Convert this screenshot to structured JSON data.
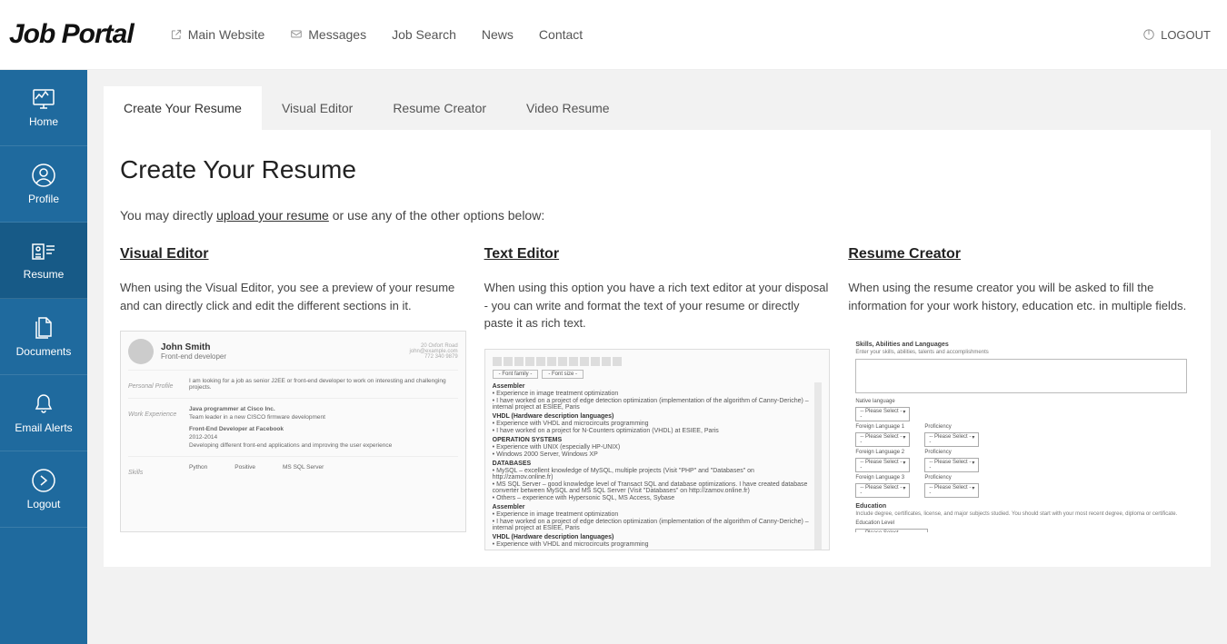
{
  "brand": "Job Portal",
  "topnav": {
    "main_website": "Main Website",
    "messages": "Messages",
    "job_search": "Job Search",
    "news": "News",
    "contact": "Contact"
  },
  "logout": "LOGOUT",
  "sidebar": {
    "home": "Home",
    "profile": "Profile",
    "resume": "Resume",
    "documents": "Documents",
    "email_alerts": "Email Alerts",
    "logout": "Logout"
  },
  "tabs": {
    "create": "Create Your Resume",
    "visual": "Visual Editor",
    "creator": "Resume Creator",
    "video": "Video Resume"
  },
  "page": {
    "title": "Create Your Resume",
    "intro_prefix": "You may directly ",
    "intro_link": "upload your resume",
    "intro_suffix": " or use any of the other options below:"
  },
  "cols": {
    "visual": {
      "title": "Visual Editor",
      "desc": "When using the Visual Editor, you see a preview of your resume and can directly click and edit the different sections in it."
    },
    "text": {
      "title": "Text Editor",
      "desc": "When using this option you have a rich text editor at your disposal - you can write and format the text of your resume or directly paste it as rich text."
    },
    "creator": {
      "title": "Resume Creator",
      "desc": "When using the resume creator you will be asked to fill the information for your work history, education etc. in multiple fields."
    }
  },
  "thumb_visual": {
    "name": "John Smith",
    "role": "Front-end developer",
    "contact1": "20 Oxfort Road",
    "contact2": "john@example.com",
    "contact3": "772 340 9879",
    "profile_h": "Personal Profile",
    "profile_t": "I am looking for a job as senior J2EE or front-end developer to work on interesting and challenging projects.",
    "work_h": "Work Experience",
    "work1_t": "Java programmer at Cisco Inc.",
    "work1_d": "Team leader in a new CISCO firmware development",
    "work2_t": "Front-End Developer at Facebook",
    "work2_y": "2012-2014",
    "work2_d": "Developing different front-end applications and improving the user experience",
    "skills_h": "Skills",
    "skill1": "Python",
    "skill2": "Positive",
    "skill3": "MS SQL Server"
  },
  "thumb_text": {
    "font_family": "- Font family -",
    "font_size": "- Font size -",
    "h1": "Assembler",
    "l1": "Experience in image treatment optimization",
    "l2": "I have worked on a project of edge detection optimization (implementation of the algorithm of Canny-Deriche) – internal project at ESIEE, Paris",
    "h2": "VHDL (Hardware description languages)",
    "l3": "Experience with VHDL and microcircuits programming",
    "l4": "I have worked on a project for N-Counters optimization (VHDL) at ESIEE, Paris",
    "h3": "OPERATION SYSTEMS",
    "l5": "Experience with UNIX (especially HP-UNIX)",
    "l6": "Windows 2000 Server, Windows XP",
    "h4": "DATABASES",
    "l7": "MySQL – excellent knowledge of MySQL, multiple projects (Visit \"PHP\" and \"Databases\" on http://zamov.online.fr)",
    "l8": "MS SQL Server – good knowledge level of Transact SQL and database optimizations. I have created database converter between MySQL and MS SQL Server (Visit \"Databases\" on http://zamov.online.fr)",
    "l9": "Others – experience with Hypersonic SQL, MS Access, Sybase"
  },
  "thumb_form": {
    "h1": "Skills, Abilities and Languages",
    "h1_sub": "Enter your skills, abilities, talents and accomplishments",
    "native": "Native language",
    "fl1": "Foreign Language 1",
    "fl2": "Foreign Language 2",
    "fl3": "Foreign Language 3",
    "prof": "Proficiency",
    "select": "-- Please Select --",
    "h2": "Education",
    "h2_sub": "Include degree, certificates, license, and major subjects studied. You should start with your most recent degree, diploma or certificate.",
    "edu_level": "Education Level"
  }
}
